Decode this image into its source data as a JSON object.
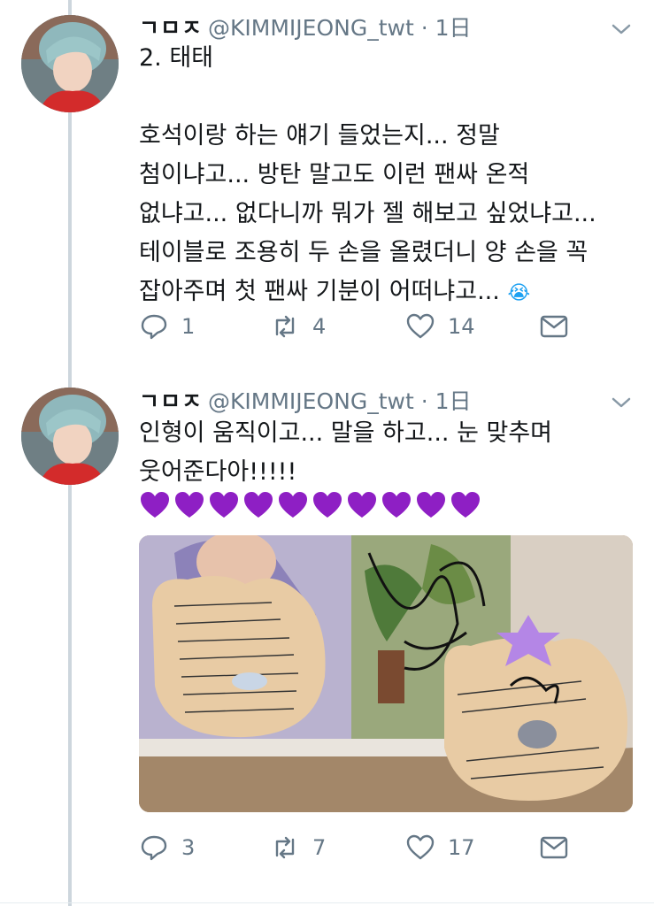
{
  "tweets": [
    {
      "display_name": "ㄱㅁㅈ",
      "handle": "@KIMMIJEONG_twt",
      "time": "· 1日",
      "text": "2. 태태\n\n호석이랑 하는 얘기 들었는지... 정말\n첨이냐고... 방탄 말고도 이런 팬싸 온적\n없냐고... 없다니까 뭐가 젤 해보고 싶었냐고...\n테이블로 조용히 두 손을 올렸더니 양 손을 꼭\n잡아주며 첫 팬싸 기분이 어떠냐고...",
      "emoji": "😭",
      "replies": "1",
      "retweets": "4",
      "likes": "14"
    },
    {
      "display_name": "ㄱㅁㅈ",
      "handle": "@KIMMIJEONG_twt",
      "time": "· 1日",
      "text": "인형이 움직이고... 말을 하고... 눈 맞추며\n웃어준다아!!!!!",
      "heart_count": 10,
      "heart_color": "#8e1fc4",
      "replies": "3",
      "retweets": "7",
      "likes": "17"
    }
  ],
  "icons": {
    "reply": "reply-icon",
    "retweet": "retweet-icon",
    "like": "like-icon",
    "message": "message-icon",
    "chevron": "chevron-down-icon"
  },
  "colors": {
    "thread_line": "#cdd6dd",
    "meta": "#657786",
    "text": "#14171a"
  }
}
